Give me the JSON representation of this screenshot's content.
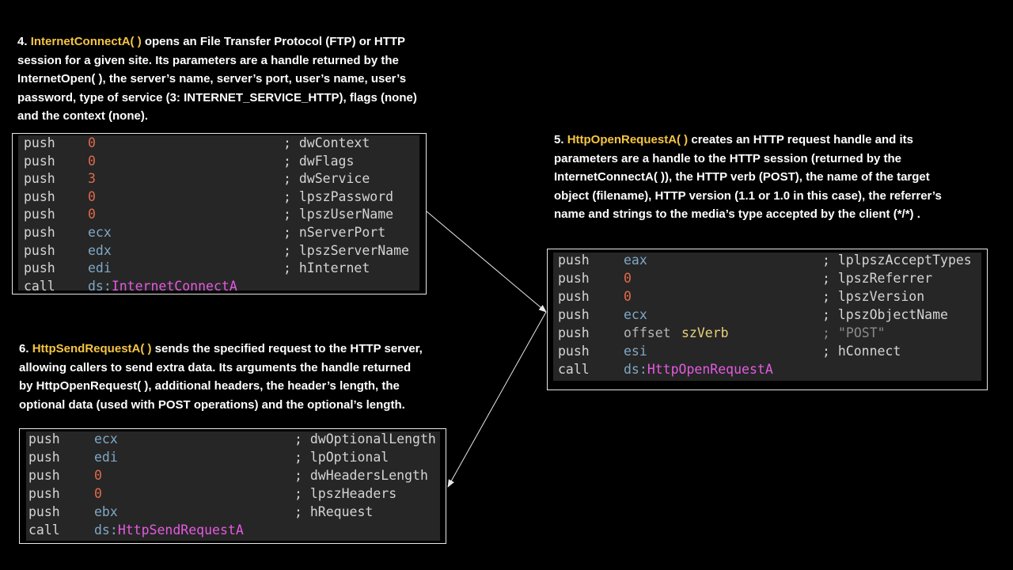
{
  "sections": {
    "s4": {
      "num": "4. ",
      "fn": "InternetConnectA( )",
      "lines": [
        " opens an File Transfer Protocol (FTP) or HTTP",
        "session for a given site. Its parameters are a handle returned by the",
        "InternetOpen( ), the server’s name, server’s port, user’s name, user’s",
        "password, type of service (3: INTERNET_SERVICE_HTTP), flags (none)",
        "and the context (none)."
      ]
    },
    "s5": {
      "num": "5. ",
      "fn": "HttpOpenRequestA( )",
      "lines": [
        " creates an HTTP request handle and its",
        "parameters are a handle to the HTTP session (returned by the",
        "InternetConnectA( )), the HTTP verb (POST), the name of the target",
        "object (filename), HTTP version (1.1 or 1.0 in this case), the referrer’s",
        "name and  strings to the media’s type accepted by the client (*/*) ."
      ]
    },
    "s6": {
      "num": "6. ",
      "fn": "HttpSendRequestA( )",
      "lines": [
        " sends the specified request to the HTTP server,",
        "allowing callers to send extra data. Its arguments the handle returned",
        "by HttpOpenRequest( ), additional headers, the header’s length, the",
        "optional data (used with POST operations) and the optional’s length."
      ]
    }
  },
  "code_connect": [
    {
      "mn": "push",
      "op": "0",
      "cm": "; dwContext"
    },
    {
      "mn": "push",
      "op": "0",
      "cm": "; dwFlags"
    },
    {
      "mn": "push",
      "op": "3",
      "cm": "; dwService"
    },
    {
      "mn": "push",
      "op": "0",
      "cm": "; lpszPassword"
    },
    {
      "mn": "push",
      "op": "0",
      "cm": "; lpszUserName"
    },
    {
      "mn": "push",
      "op": "ecx",
      "cm": "; nServerPort"
    },
    {
      "mn": "push",
      "op": "edx",
      "cm": "; lpszServerName"
    },
    {
      "mn": "push",
      "op": "edi",
      "cm": "; hInternet"
    },
    {
      "mn": "call",
      "ds": "ds:",
      "api": "InternetConnectA"
    }
  ],
  "code_open": [
    {
      "mn": "push",
      "op": "eax",
      "cm": "; lplpszAcceptTypes"
    },
    {
      "mn": "push",
      "op": "0",
      "cm": "; lpszReferrer"
    },
    {
      "mn": "push",
      "op": "0",
      "cm": "; lpszVersion"
    },
    {
      "mn": "push",
      "op": "ecx",
      "cm": "; lpszObjectName"
    },
    {
      "mn": "push",
      "kw": "offset",
      "sym": "szVerb",
      "semi": ";",
      "str": "\"POST\""
    },
    {
      "mn": "push",
      "op": "esi",
      "cm": "; hConnect"
    },
    {
      "mn": "call",
      "ds": "ds:",
      "api": "HttpOpenRequestA"
    }
  ],
  "code_send": [
    {
      "mn": "push",
      "op": "ecx",
      "cm": "; dwOptionalLength"
    },
    {
      "mn": "push",
      "op": "edi",
      "cm": "; lpOptional"
    },
    {
      "mn": "push",
      "op": "0",
      "cm": "; dwHeadersLength"
    },
    {
      "mn": "push",
      "op": "0",
      "cm": "; lpszHeaders"
    },
    {
      "mn": "push",
      "op": "ebx",
      "cm": "; hRequest"
    },
    {
      "mn": "call",
      "ds": "ds:",
      "api": "HttpSendRequestA"
    }
  ]
}
